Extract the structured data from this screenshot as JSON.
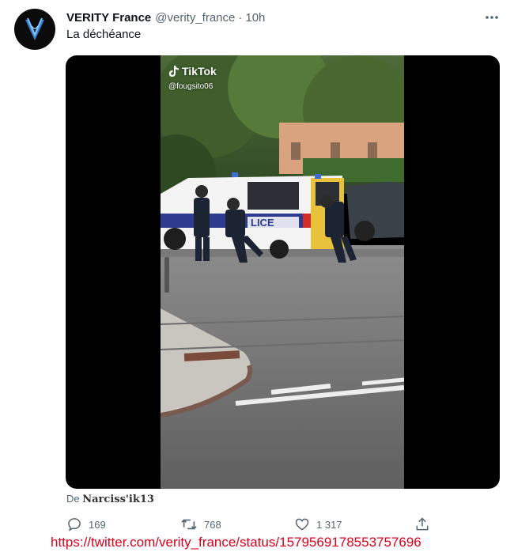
{
  "author": {
    "display_name": "VERITY France",
    "handle": "@verity_france",
    "separator": "·",
    "timestamp": "10h",
    "avatar_icon": "verity-logo-icon"
  },
  "tweet": {
    "text": "La déchéance"
  },
  "media": {
    "tiktok_label": "TikTok",
    "tiktok_user": "@fougsito06",
    "van_text": "LICE"
  },
  "attribution": {
    "prefix": "De",
    "author": "Narciss'ik13"
  },
  "actions": {
    "reply_count": "169",
    "retweet_count": "768",
    "like_count": "1 317"
  },
  "overlay_url": "https://twitter.com/verity_france/status/1579569178553757696",
  "colors": {
    "text": "#0f1419",
    "secondary": "#536471",
    "overlay_red": "#d9001b"
  }
}
